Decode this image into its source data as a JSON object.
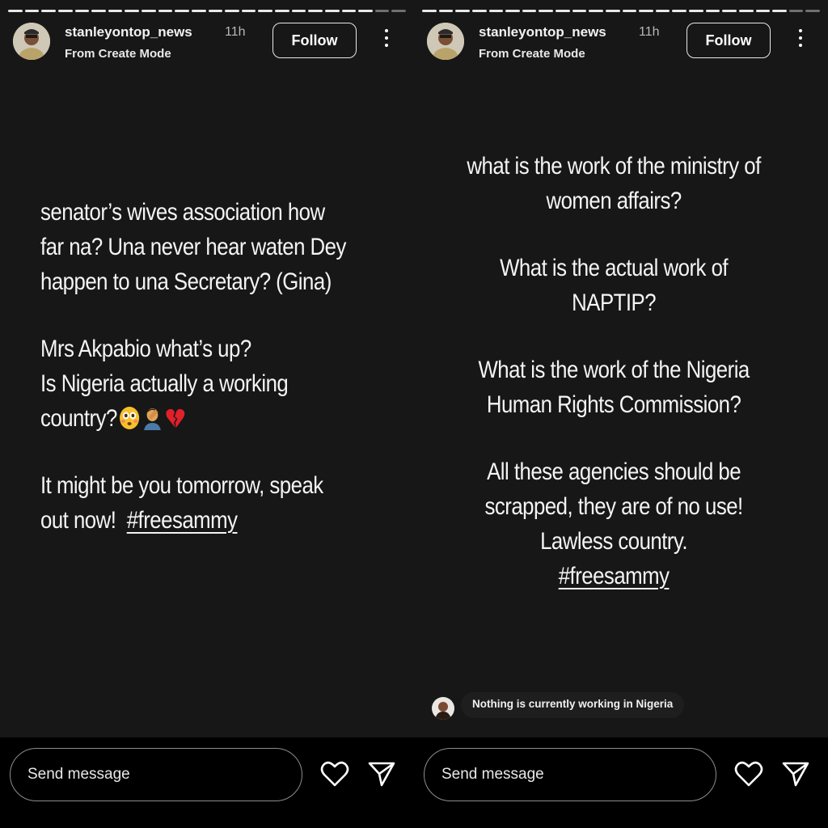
{
  "stories": [
    {
      "username": "stanleyontop_news",
      "time": "11h",
      "subtitle": "From Create Mode",
      "follow_label": "Follow",
      "lines_block1": [
        "senator’s wives association how",
        "far na? Una never hear waten Dey",
        "happen to una Secretary? (Gina)"
      ],
      "lines_block2": [
        "Mrs Akpabio what’s up?",
        "Is Nigeria actually a working",
        "country?"
      ],
      "emoji_names": [
        "flushed-face-emoji",
        "facepalm-emoji",
        "broken-heart-emoji"
      ],
      "lines_block3": [
        "It might be you tomorrow, speak",
        "out now!"
      ],
      "hashtag": "#freesammy",
      "send_placeholder": "Send message"
    },
    {
      "username": "stanleyontop_news",
      "time": "11h",
      "subtitle": "From Create Mode",
      "follow_label": "Follow",
      "lines_block1": [
        "what is the work of the ministry of",
        "women affairs?"
      ],
      "lines_block2": [
        "What is the actual work of",
        "NAPTIP?"
      ],
      "lines_block3": [
        "What is the work of the Nigeria",
        "Human Rights Commission?"
      ],
      "lines_block4": [
        "All these agencies should be",
        "scrapped, they are of no use!",
        "Lawless country."
      ],
      "hashtag": "#freesammy",
      "reply_text": "Nothing is currently working in Nigeria",
      "send_placeholder": "Send message"
    }
  ],
  "icons": [
    "heart-icon",
    "send-icon",
    "more-options-icon"
  ],
  "colors": {
    "background": "#171717",
    "footer": "#000000",
    "text": "#f4f4f4"
  }
}
